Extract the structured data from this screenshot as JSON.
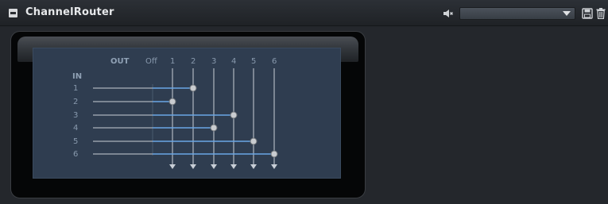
{
  "window": {
    "title": "ChannelRouter"
  },
  "toolbar": {
    "mute_icon": "speaker-muted-icon",
    "preset_value": "",
    "save_icon": "floppy-disk-icon",
    "delete_icon": "trash-icon"
  },
  "matrix": {
    "out_label": "OUT",
    "off_label": "Off",
    "in_label": "IN",
    "outputs": [
      "1",
      "2",
      "3",
      "4",
      "5",
      "6"
    ],
    "inputs": [
      "1",
      "2",
      "3",
      "4",
      "5",
      "6"
    ],
    "routing": [
      2,
      1,
      4,
      3,
      5,
      6
    ]
  },
  "colors": {
    "matrix_bg": "#2f3d50",
    "line": "#c8ced6",
    "active_line": "#6aa6e6",
    "knob": "#c9ccd0"
  }
}
